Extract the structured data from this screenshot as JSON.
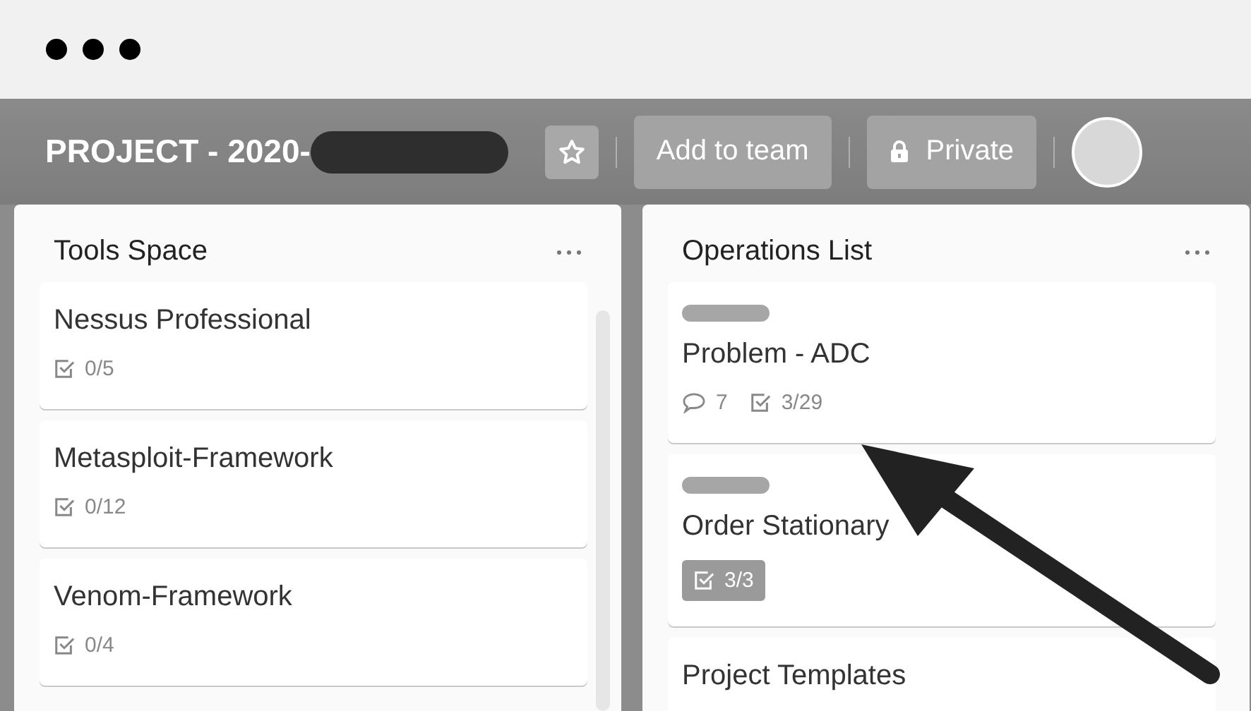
{
  "board": {
    "title": "PROJECT - 2020-",
    "buttons": [
      {
        "kind": "team",
        "label": "Add to team"
      },
      {
        "kind": "visibility",
        "label": "Private"
      }
    ]
  },
  "lists": [
    {
      "title": "Tools Space",
      "scrollbar": true,
      "cards": [
        {
          "title": "Nessus Professional",
          "badges": [
            {
              "kind": "checklist",
              "text": "0/5",
              "complete": false
            }
          ]
        },
        {
          "title": "Metasploit-Framework",
          "badges": [
            {
              "kind": "checklist",
              "text": "0/12",
              "complete": false
            }
          ]
        },
        {
          "title": "Venom-Framework",
          "badges": [
            {
              "kind": "checklist",
              "text": "0/4",
              "complete": false
            }
          ]
        }
      ]
    },
    {
      "title": "Operations List",
      "scrollbar": false,
      "cards": [
        {
          "title": "Problem - ADC",
          "labels": [
            {
              "color": "#a6a6a6"
            }
          ],
          "badges": [
            {
              "kind": "comments",
              "text": "7"
            },
            {
              "kind": "checklist",
              "text": "3/29",
              "complete": false
            }
          ]
        },
        {
          "title": "Order Stationary",
          "labels": [
            {
              "color": "#a6a6a6"
            }
          ],
          "badges": [
            {
              "kind": "checklist",
              "text": "3/3",
              "complete": true
            }
          ]
        },
        {
          "title": "Project Templates"
        }
      ]
    }
  ]
}
